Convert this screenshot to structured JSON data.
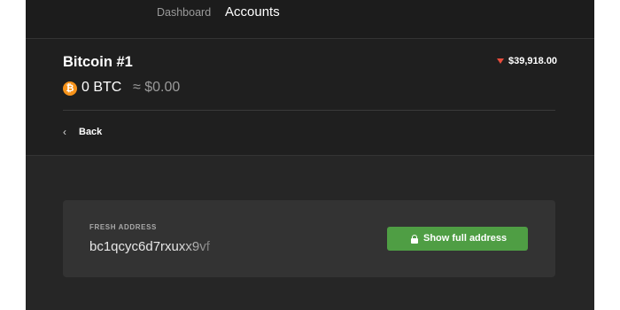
{
  "nav": {
    "tabs": [
      {
        "label": "Dashboard"
      },
      {
        "label": "Accounts"
      }
    ]
  },
  "account": {
    "name": "Bitcoin #1",
    "coin_icon": "bitcoin-icon",
    "coin_symbol": "₿",
    "balance": "0 BTC",
    "fiat_balance": "≈ $0.00",
    "price_trend_icon": "down-triangle-icon",
    "price": "$39,918.00"
  },
  "back": {
    "icon": "chevron-left-icon",
    "glyph": "‹",
    "label": "Back"
  },
  "address_card": {
    "label": "FRESH ADDRESS",
    "address": "bc1qcyc6d7rxuxx9vf",
    "button_icon": "lock-icon",
    "button_label": "Show full address"
  },
  "colors": {
    "accent_green": "#4f9e44",
    "price_down_red": "#e74c3c",
    "bitcoin_orange": "#f7931a"
  }
}
